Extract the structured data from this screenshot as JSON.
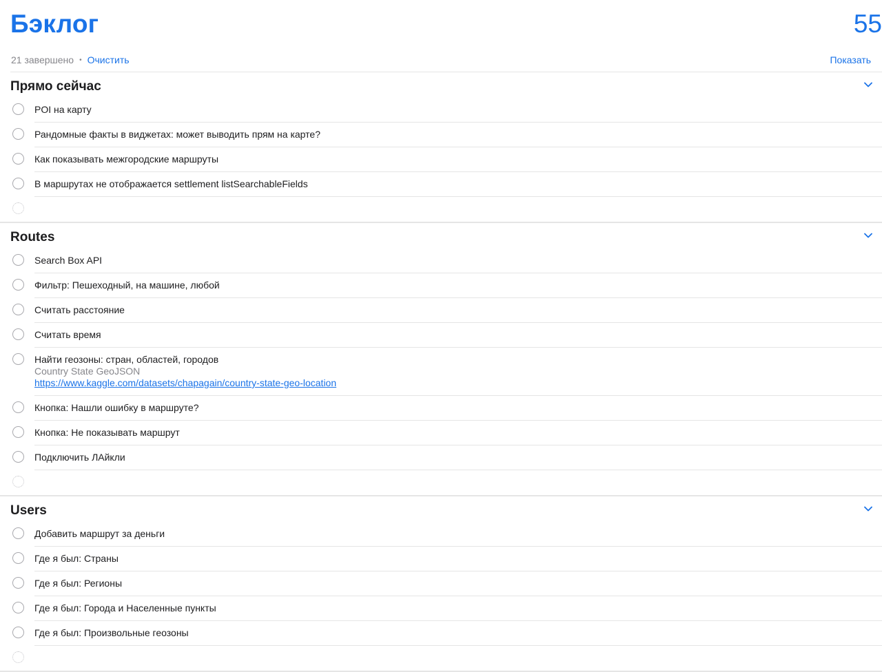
{
  "header": {
    "title": "Бэклог",
    "count": "55",
    "completed_text": "21 завершено",
    "separator": "•",
    "clear_label": "Очистить",
    "show_label": "Показать"
  },
  "colors": {
    "accent": "#1a73e8",
    "text": "#1d1d1f",
    "secondary": "#86868b",
    "divider": "#e5e5e5"
  },
  "sections": [
    {
      "title": "Прямо сейчас",
      "icon": "chevron-down-icon",
      "tasks": [
        {
          "title": "POI на карту"
        },
        {
          "title": "Рандомные факты в виджетах: может выводить прям на карте?"
        },
        {
          "title": "Как показывать межгородские маршруты"
        },
        {
          "title": "В маршрутах не отображается settlement listSearchableFields"
        }
      ]
    },
    {
      "title": "Routes",
      "icon": "chevron-down-icon",
      "tasks": [
        {
          "title": "Search Box API"
        },
        {
          "title": "Фильтр: Пешеходный, на машине, любой"
        },
        {
          "title": "Считать расстояние"
        },
        {
          "title": "Считать время"
        },
        {
          "title": "Найти геозоны: стран, областей, городов",
          "notes": "Country State GeoJSON",
          "url": "https://www.kaggle.com/datasets/chapagain/country-state-geo-location"
        },
        {
          "title": "Кнопка: Нашли ошибку в маршруте?"
        },
        {
          "title": "Кнопка: Не показывать маршрут"
        },
        {
          "title": "Подключить ЛАйкли"
        }
      ]
    },
    {
      "title": "Users",
      "icon": "chevron-down-icon",
      "tasks": [
        {
          "title": "Добавить маршрут за деньги"
        },
        {
          "title": "Где я был: Страны"
        },
        {
          "title": "Где я был: Регионы"
        },
        {
          "title": "Где я был: Города и Населенные пункты"
        },
        {
          "title": "Где я был: Произвольные геозоны"
        }
      ]
    }
  ]
}
